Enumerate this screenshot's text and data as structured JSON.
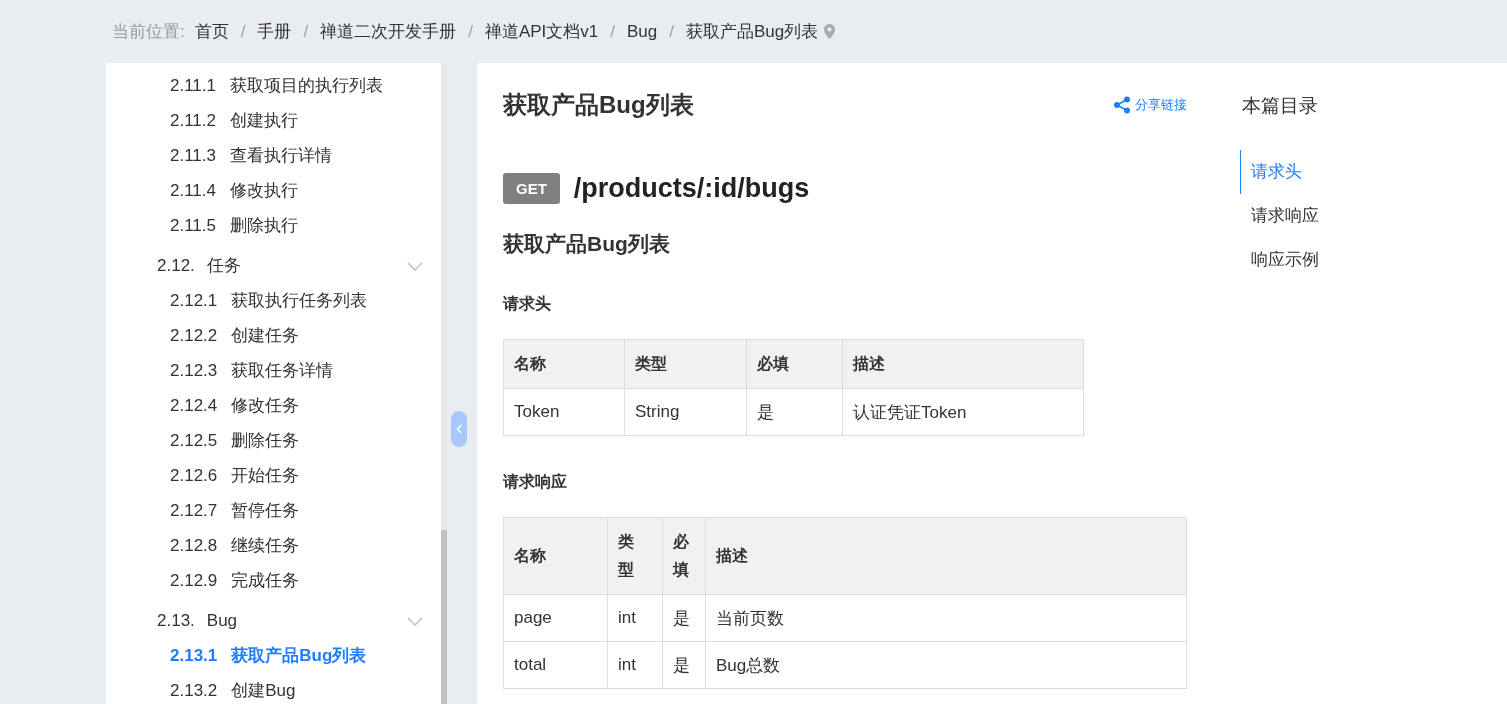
{
  "breadcrumb": {
    "label": "当前位置:",
    "separator": "/",
    "items": [
      "首页",
      "手册",
      "禅道二次开发手册",
      "禅道API文档v1",
      "Bug",
      "获取产品Bug列表"
    ]
  },
  "sidebar": {
    "items": [
      {
        "kind": "item",
        "number": "2.11.1",
        "label": "获取项目的执行列表",
        "selected": false
      },
      {
        "kind": "item",
        "number": "2.11.2",
        "label": "创建执行",
        "selected": false
      },
      {
        "kind": "item",
        "number": "2.11.3",
        "label": "查看执行详情",
        "selected": false
      },
      {
        "kind": "item",
        "number": "2.11.4",
        "label": "修改执行",
        "selected": false
      },
      {
        "kind": "item",
        "number": "2.11.5",
        "label": "删除执行",
        "selected": false
      },
      {
        "kind": "group",
        "number": "2.12.",
        "label": "任务",
        "expanded": true,
        "children": [
          {
            "number": "2.12.1",
            "label": "获取执行任务列表",
            "selected": false
          },
          {
            "number": "2.12.2",
            "label": "创建任务",
            "selected": false
          },
          {
            "number": "2.12.3",
            "label": "获取任务详情",
            "selected": false
          },
          {
            "number": "2.12.4",
            "label": "修改任务",
            "selected": false
          },
          {
            "number": "2.12.5",
            "label": "删除任务",
            "selected": false
          },
          {
            "number": "2.12.6",
            "label": "开始任务",
            "selected": false
          },
          {
            "number": "2.12.7",
            "label": "暂停任务",
            "selected": false
          },
          {
            "number": "2.12.8",
            "label": "继续任务",
            "selected": false
          },
          {
            "number": "2.12.9",
            "label": "完成任务",
            "selected": false
          }
        ]
      },
      {
        "kind": "group",
        "number": "2.13.",
        "label": "Bug",
        "expanded": true,
        "children": [
          {
            "number": "2.13.1",
            "label": "获取产品Bug列表",
            "selected": true
          },
          {
            "number": "2.13.2",
            "label": "创建Bug",
            "selected": false
          }
        ]
      }
    ]
  },
  "article": {
    "title": "获取产品Bug列表",
    "share": "分享链接",
    "method": "GET",
    "path": "/products/:id/bugs",
    "subtitle": "获取产品Bug列表",
    "sections": [
      {
        "heading": "请求头",
        "table": {
          "columns": [
            "名称",
            "类型",
            "必填",
            "描述"
          ],
          "rows": [
            [
              "Token",
              "String",
              "是",
              "认证凭证Token"
            ]
          ]
        }
      },
      {
        "heading": "请求响应",
        "table": {
          "columns": [
            "名称",
            "类型",
            "必填",
            "描述"
          ],
          "rows": [
            [
              "page",
              "int",
              "是",
              "当前页数"
            ],
            [
              "total",
              "int",
              "是",
              "Bug总数"
            ]
          ]
        }
      }
    ]
  },
  "toc": {
    "title": "本篇目录",
    "items": [
      {
        "label": "请求头",
        "selected": true
      },
      {
        "label": "请求响应",
        "selected": false
      },
      {
        "label": "响应示例",
        "selected": false
      }
    ]
  }
}
